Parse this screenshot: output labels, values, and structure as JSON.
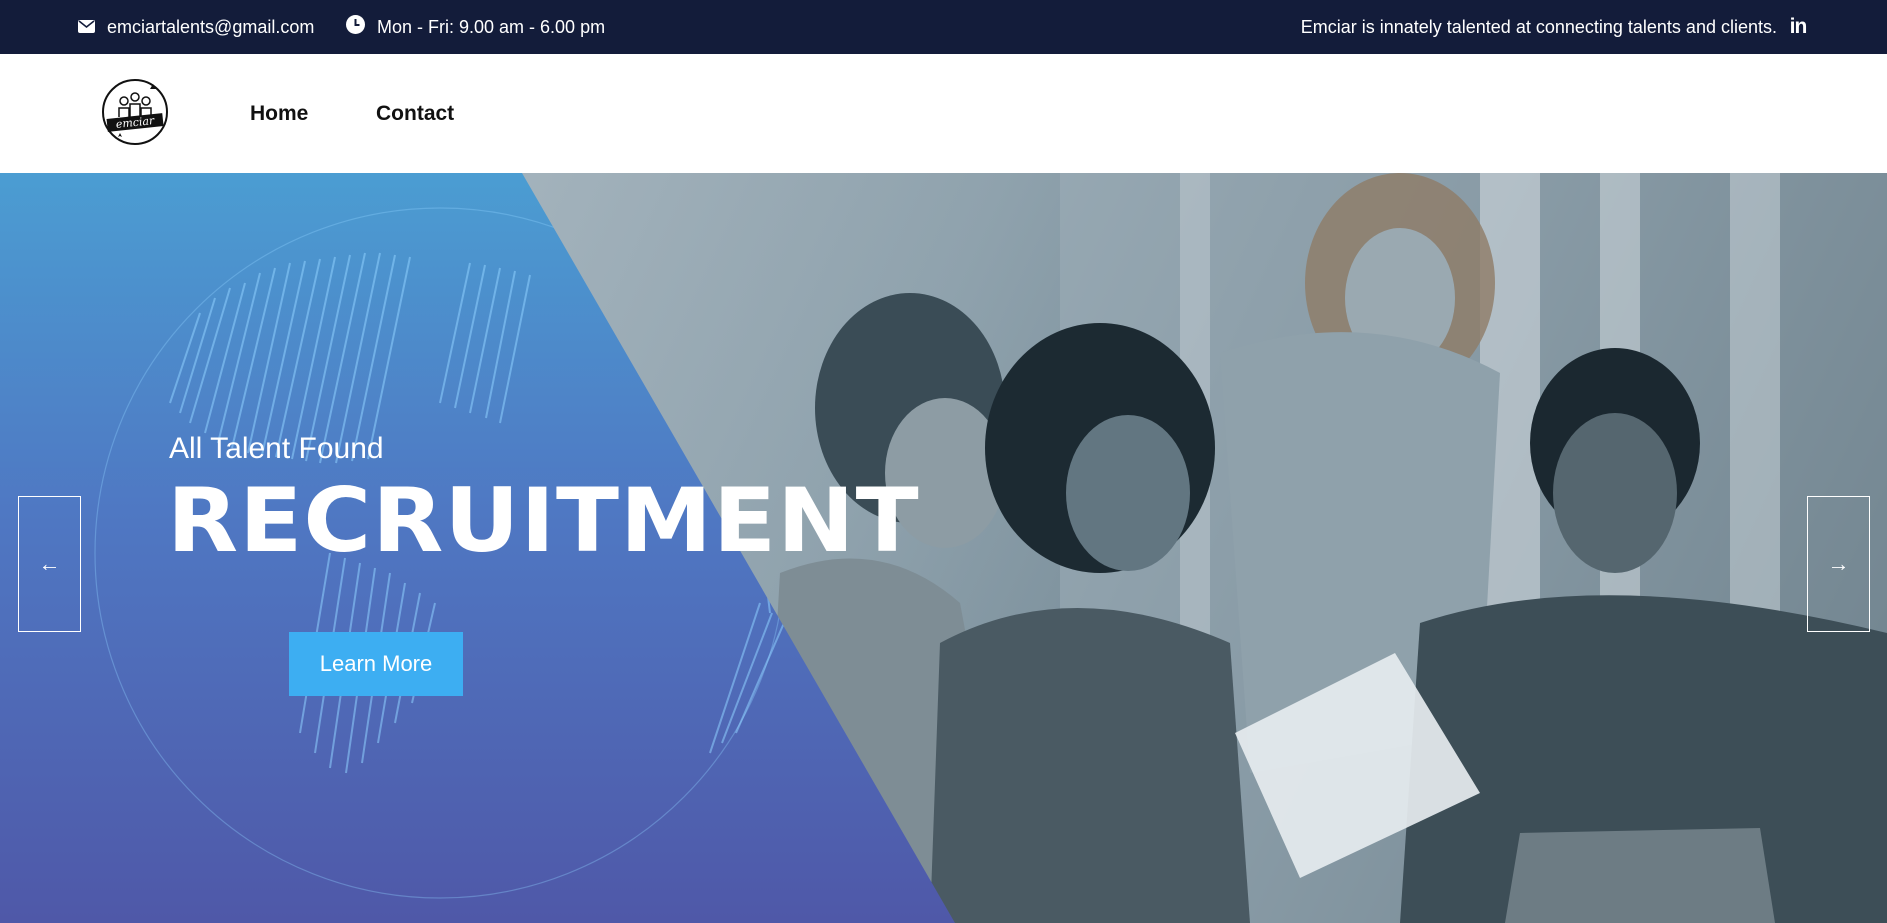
{
  "topbar": {
    "email": "emciartalents@gmail.com",
    "email_icon": "mail-icon",
    "hours": "Mon - Fri: 9.00 am - 6.00 pm",
    "hours_icon": "clock-icon",
    "tagline": "Emciar is innately talented at connecting talents and clients.",
    "social_icon": "linkedin-icon",
    "social_label": "in"
  },
  "nav": {
    "logo_text": "emciar",
    "items": [
      {
        "label": "Home"
      },
      {
        "label": "Contact"
      }
    ]
  },
  "hero": {
    "subtitle": "All Talent Found",
    "title": "RECRUITMENT",
    "button_label": "Learn More",
    "prev_arrow": "←",
    "next_arrow": "→",
    "panel_colors": [
      "#4b9dd2",
      "#4f78c3",
      "#4f58a8"
    ],
    "button_color": "#3daef2"
  },
  "colors": {
    "topbar_bg": "#131c3a",
    "accent": "#3daef2"
  }
}
